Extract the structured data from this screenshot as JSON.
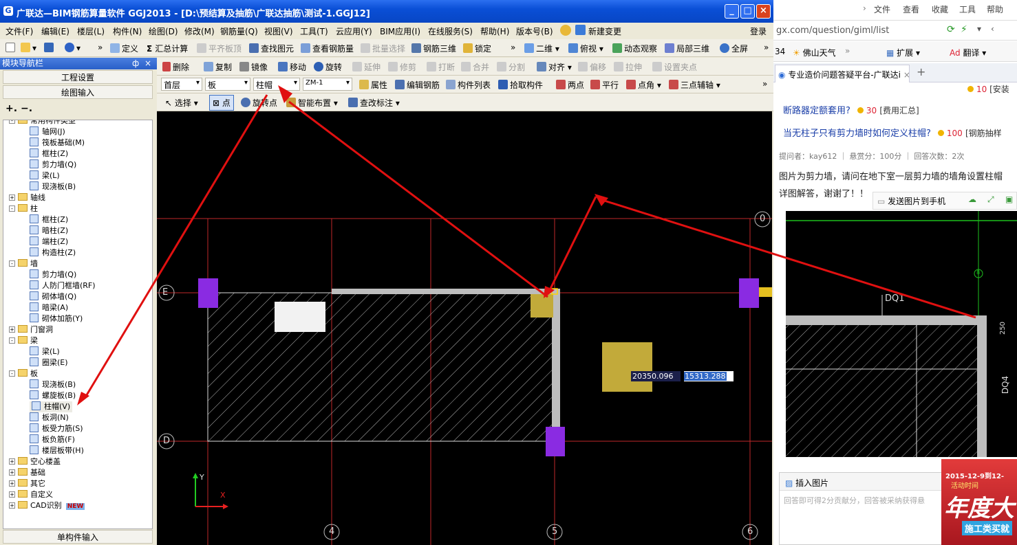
{
  "window": {
    "title": "广联达—BIM钢筋算量软件 GGJ2013 - [D:\\预结算及抽筋\\广联达抽筋\\测试-1.GGJ12]"
  },
  "menu": [
    "文件(F)",
    "编辑(E)",
    "楼层(L)",
    "构件(N)",
    "绘图(D)",
    "修改(M)",
    "钢筋量(Q)",
    "视图(V)",
    "工具(T)",
    "云应用(Y)",
    "BIM应用(I)",
    "在线服务(S)",
    "帮助(H)",
    "版本号(B)",
    "新建变更"
  ],
  "login": "登录",
  "toolbar1": {
    "define": "定义",
    "calc": "汇总计算",
    "flat_board": "平齐板顶",
    "find": "查找图元",
    "view_rebar": "查看钢筋量",
    "batch": "批量选择",
    "rebar3d": "钢筋三维",
    "lock": "锁定",
    "view2d": "二维",
    "view_top": "俯视",
    "dynamic": "动态观察",
    "local3d": "局部三维",
    "fullscreen": "全屏"
  },
  "toolbar2": {
    "delete": "删除",
    "copy": "复制",
    "mirror": "镜像",
    "move": "移动",
    "rotate": "旋转",
    "extend": "延伸",
    "trim": "修剪",
    "break": "打断",
    "merge": "合并",
    "split": "分割",
    "align": "对齐",
    "offset": "偏移",
    "stretch": "拉伸",
    "grip": "设置夹点"
  },
  "toolbar3": {
    "floor": "首层",
    "category": "板",
    "component": "柱帽",
    "name": "ZM-1",
    "properties": "属性",
    "edit_rebar": "编辑钢筋",
    "comp_list": "构件列表",
    "pick": "拾取构件",
    "two_point": "两点",
    "parallel": "平行",
    "point_angle": "点角",
    "three_point": "三点辅轴"
  },
  "toolbar4": {
    "select": "选择",
    "point": "点",
    "rotate_point": "旋转点",
    "smart": "智能布置",
    "check_mark": "查改标注"
  },
  "nav": {
    "title": "模块导航栏",
    "project_settings": "工程设置",
    "drawing_input": "绘图输入",
    "single_input": "单构件输入"
  },
  "tree": [
    {
      "t": "常用构件类型",
      "lvl": 0,
      "type": "folder",
      "exp": "-"
    },
    {
      "t": "轴网(J)",
      "lvl": 1
    },
    {
      "t": "筏板基础(M)",
      "lvl": 1
    },
    {
      "t": "框柱(Z)",
      "lvl": 1
    },
    {
      "t": "剪力墙(Q)",
      "lvl": 1
    },
    {
      "t": "梁(L)",
      "lvl": 1
    },
    {
      "t": "现浇板(B)",
      "lvl": 1
    },
    {
      "t": "轴线",
      "lvl": 0,
      "type": "folder",
      "exp": "+"
    },
    {
      "t": "柱",
      "lvl": 0,
      "type": "folder",
      "exp": "-"
    },
    {
      "t": "框柱(Z)",
      "lvl": 1
    },
    {
      "t": "暗柱(Z)",
      "lvl": 1
    },
    {
      "t": "端柱(Z)",
      "lvl": 1
    },
    {
      "t": "构造柱(Z)",
      "lvl": 1
    },
    {
      "t": "墙",
      "lvl": 0,
      "type": "folder",
      "exp": "-"
    },
    {
      "t": "剪力墙(Q)",
      "lvl": 1
    },
    {
      "t": "人防门框墙(RF)",
      "lvl": 1
    },
    {
      "t": "砌体墙(Q)",
      "lvl": 1
    },
    {
      "t": "暗梁(A)",
      "lvl": 1
    },
    {
      "t": "砌体加筋(Y)",
      "lvl": 1
    },
    {
      "t": "门窗洞",
      "lvl": 0,
      "type": "folder",
      "exp": "+"
    },
    {
      "t": "梁",
      "lvl": 0,
      "type": "folder",
      "exp": "-"
    },
    {
      "t": "梁(L)",
      "lvl": 1
    },
    {
      "t": "圈梁(E)",
      "lvl": 1
    },
    {
      "t": "板",
      "lvl": 0,
      "type": "folder",
      "exp": "-"
    },
    {
      "t": "现浇板(B)",
      "lvl": 1
    },
    {
      "t": "螺旋板(B)",
      "lvl": 1
    },
    {
      "t": "柱帽(V)",
      "lvl": 1,
      "selected": true
    },
    {
      "t": "板洞(N)",
      "lvl": 1
    },
    {
      "t": "板受力筋(S)",
      "lvl": 1
    },
    {
      "t": "板负筋(F)",
      "lvl": 1
    },
    {
      "t": "楼层板带(H)",
      "lvl": 1
    },
    {
      "t": "空心楼盖",
      "lvl": 0,
      "type": "folder",
      "exp": "+"
    },
    {
      "t": "基础",
      "lvl": 0,
      "type": "folder",
      "exp": "+"
    },
    {
      "t": "其它",
      "lvl": 0,
      "type": "folder",
      "exp": "+"
    },
    {
      "t": "自定义",
      "lvl": 0,
      "type": "folder",
      "exp": "+"
    },
    {
      "t": "CAD识别",
      "lvl": 0,
      "type": "folder",
      "exp": "+",
      "badge": "NEW"
    }
  ],
  "canvas": {
    "axis_E": "E",
    "axis_D": "D",
    "axis_4": "4",
    "axis_5": "5",
    "axis_6": "6",
    "axis_0": "0",
    "coord_x": "20350.096",
    "coord_y": "15313.288",
    "ucs_y": "Y",
    "ucs_x": "X"
  },
  "browser": {
    "menu": [
      "文件",
      "查看",
      "收藏",
      "工具",
      "帮助"
    ],
    "url": "gx.com/question/giml/list",
    "fav_prefix": "34",
    "weather": "佛山天气",
    "extend": "扩展",
    "translate": "翻译",
    "tab_title": "专业造价问题答疑平台-广联达i",
    "q_top_score": "10",
    "q_top_tag": "[安装算",
    "q1": "断路器定额套用?",
    "q1_score": "30",
    "q1_tag": "[费用汇总]",
    "q2": "当无柱子只有剪力墙时如何定义柱帽?",
    "q2_score": "100",
    "q2_tag": "[钢筋抽样",
    "meta": "提问者：kay612  ｜  悬赏分：100分  ｜  回答次数：2次",
    "body1": "图片为剪力墙，请问在地下室一层剪力墙的墙角设置柱帽",
    "body2": "详图解答，谢谢了！！",
    "send_to_phone": "发送图片到手机",
    "img_dq1": "DQ1",
    "img_dq4": "DQ4",
    "img_250": "250",
    "img_8": "8",
    "insert_image": "插入图片",
    "answer_placeholder": "回答即可得2分贡献分，回答被采纳获得悬",
    "ad_date": "2015-12-9到12-",
    "ad_time": "活动时间",
    "ad_big": "年度大",
    "ad_sub": "施工类买就"
  },
  "colors": {
    "titlebar": "#0a4fd6",
    "canvas_bg": "#000000",
    "grid": "#c0282a",
    "column": "#8a2be2",
    "cap": "#c2aa3a",
    "arrow": "#e01010"
  }
}
